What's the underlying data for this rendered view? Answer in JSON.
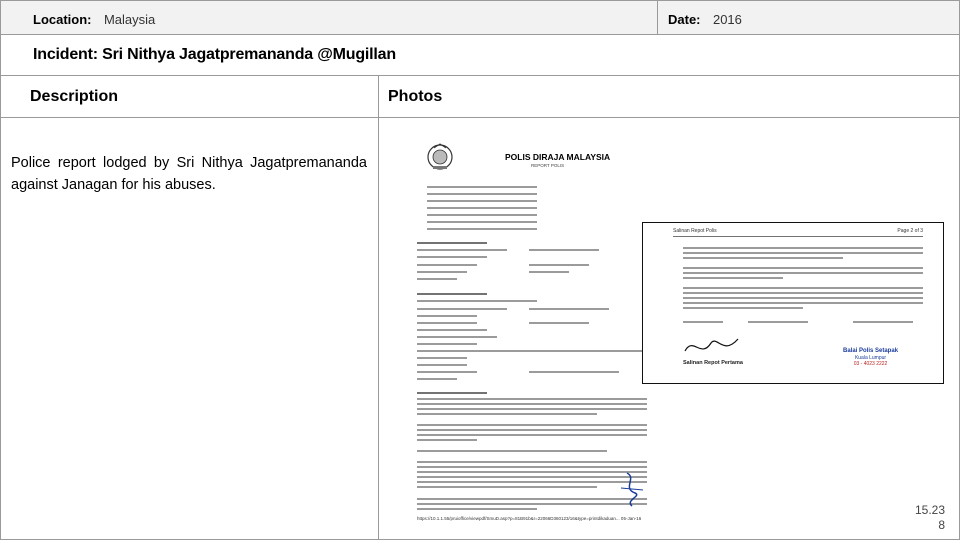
{
  "header": {
    "location_label": "Location:",
    "location_value": "Malaysia",
    "date_label": "Date:",
    "date_value": "2016"
  },
  "incident": {
    "title": "Incident: Sri Nithya Jagatpremananda @Mugillan"
  },
  "columns": {
    "description": "Description",
    "photos": "Photos"
  },
  "description": {
    "text": "Police report lodged by Sri Nithya Jagatpremananda against Janagan for his abuses."
  },
  "photo": {
    "main_doc": {
      "title": "POLIS DIRAJA MALAYSIA",
      "subtitle": "REPORT POLIS",
      "footer": "https://10.1.1.55/pruioffice/viewpdf/SmuD.asp?p=81B91b&r=22066D360123/16&type=printdikaduan... 05-Jan-16"
    },
    "overlay_doc": {
      "header_left": "Salinan Repot Polis",
      "header_right": "Page 2 of 3",
      "stamp_line1": "Balai Polis Setapak",
      "stamp_line2": "Kuala Lumpur",
      "stamp_line3": "03 - 4023 2222",
      "footer_label": "Salinan Repot Pertama"
    }
  },
  "page_number": {
    "line1": "15.23",
    "line2": "8"
  }
}
